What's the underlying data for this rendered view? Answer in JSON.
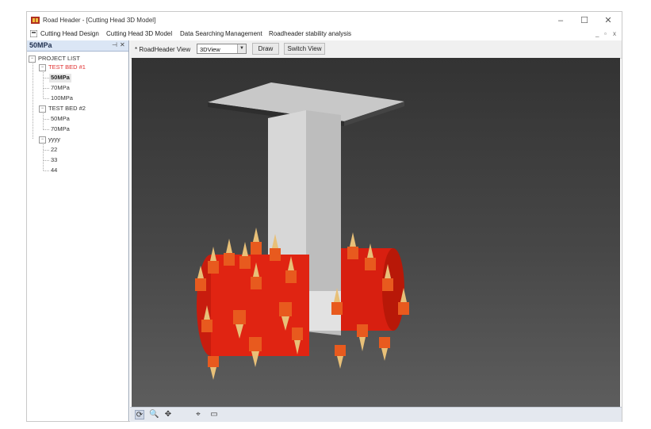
{
  "window": {
    "title": "Road Header - [Cutting Head 3D Model]",
    "controls": {
      "minimize": "–",
      "maximize": "☐",
      "close": "✕"
    }
  },
  "menubar": {
    "items": [
      "Cutting Head Design",
      "Cutting Head 3D Model",
      "Data Searching",
      "Management",
      "Roadheader stability analysis"
    ],
    "mdi_controls": {
      "minimize": "_",
      "restore": "▫",
      "close": "x"
    }
  },
  "panel": {
    "title": "50MPa",
    "pin": "⊣",
    "close": "✕",
    "tree": {
      "root": "PROJECT LIST",
      "projects": [
        {
          "label": "TEST BED #1",
          "items": [
            "50MPa",
            "70MPa",
            "100MPa"
          ]
        },
        {
          "label": "TEST BED #2",
          "items": [
            "50MPa",
            "70MPa"
          ]
        },
        {
          "label": "yyyy",
          "items": [
            "22",
            "33",
            "44"
          ]
        }
      ],
      "selected": "50MPa"
    }
  },
  "toolbar": {
    "view_label": "* RoadHeader View",
    "view_value": "3DView",
    "draw_label": "Draw",
    "switch_label": "Switch View"
  },
  "bottombar": {
    "icons": [
      "rotate-icon",
      "zoom-icon",
      "pan-icon",
      "crosshair-icon",
      "rectangle-icon"
    ]
  },
  "colors": {
    "drum_red": "#e02412",
    "bit_holder": "#e85a1e",
    "pick_tan": "#e8c078",
    "boom_grey": "#dcdcdc",
    "plate_dark": "#2e2e2e"
  }
}
